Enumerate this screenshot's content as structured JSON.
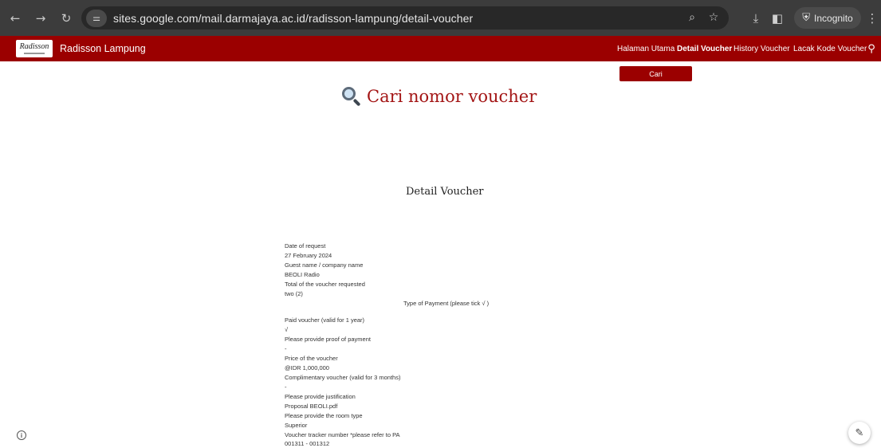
{
  "browser": {
    "back_icon": "←",
    "forward_icon": "→",
    "reload_icon": "↻",
    "site_info_icon": "⚌",
    "url": "sites.google.com/mail.darmajaya.ac.id/radisson-lampung/detail-voucher",
    "zoom_icon": "⌕",
    "star_icon": "☆",
    "download_icon": "⤓",
    "sidepanel_icon": "◧",
    "incognito_glyph": "⛨",
    "incognito_label": "Incognito",
    "menu_icon": "⋮"
  },
  "site": {
    "logo_text": "Radisson",
    "name": "Radisson Lampung",
    "nav": [
      {
        "label": "Halaman Utama"
      },
      {
        "label": "Detail Voucher"
      },
      {
        "label": "History Voucher"
      },
      {
        "label": "Lacak Kode Voucher"
      }
    ],
    "search_icon": "⚲",
    "brand_color": "#9b0000"
  },
  "content": {
    "cari_button": "Cari",
    "heading": "Cari nomor voucher",
    "detail_title": "Detail Voucher",
    "fields": [
      "Date of request",
      "27 February 2024",
      "Guest name / company name",
      "BEOLI Radio",
      "Total of the voucher requested",
      "two (2)"
    ],
    "payment_heading": "Type of Payment (please tick √ )",
    "fields2": [
      "Paid voucher (valid for 1 year)",
      "√",
      "Please provide proof of payment",
      "-",
      "Price of the voucher",
      "@IDR 1,000,000",
      "Complimentary voucher (valid for 3 months)",
      "-",
      "Please provide justification",
      "Proposal BEOLI.pdf",
      "Please provide the room type",
      "Superior",
      "Voucher tracker number *please refer to PA",
      "001311 - 001312"
    ]
  },
  "footer": {
    "info_icon": "i",
    "edit_icon": "✎"
  }
}
